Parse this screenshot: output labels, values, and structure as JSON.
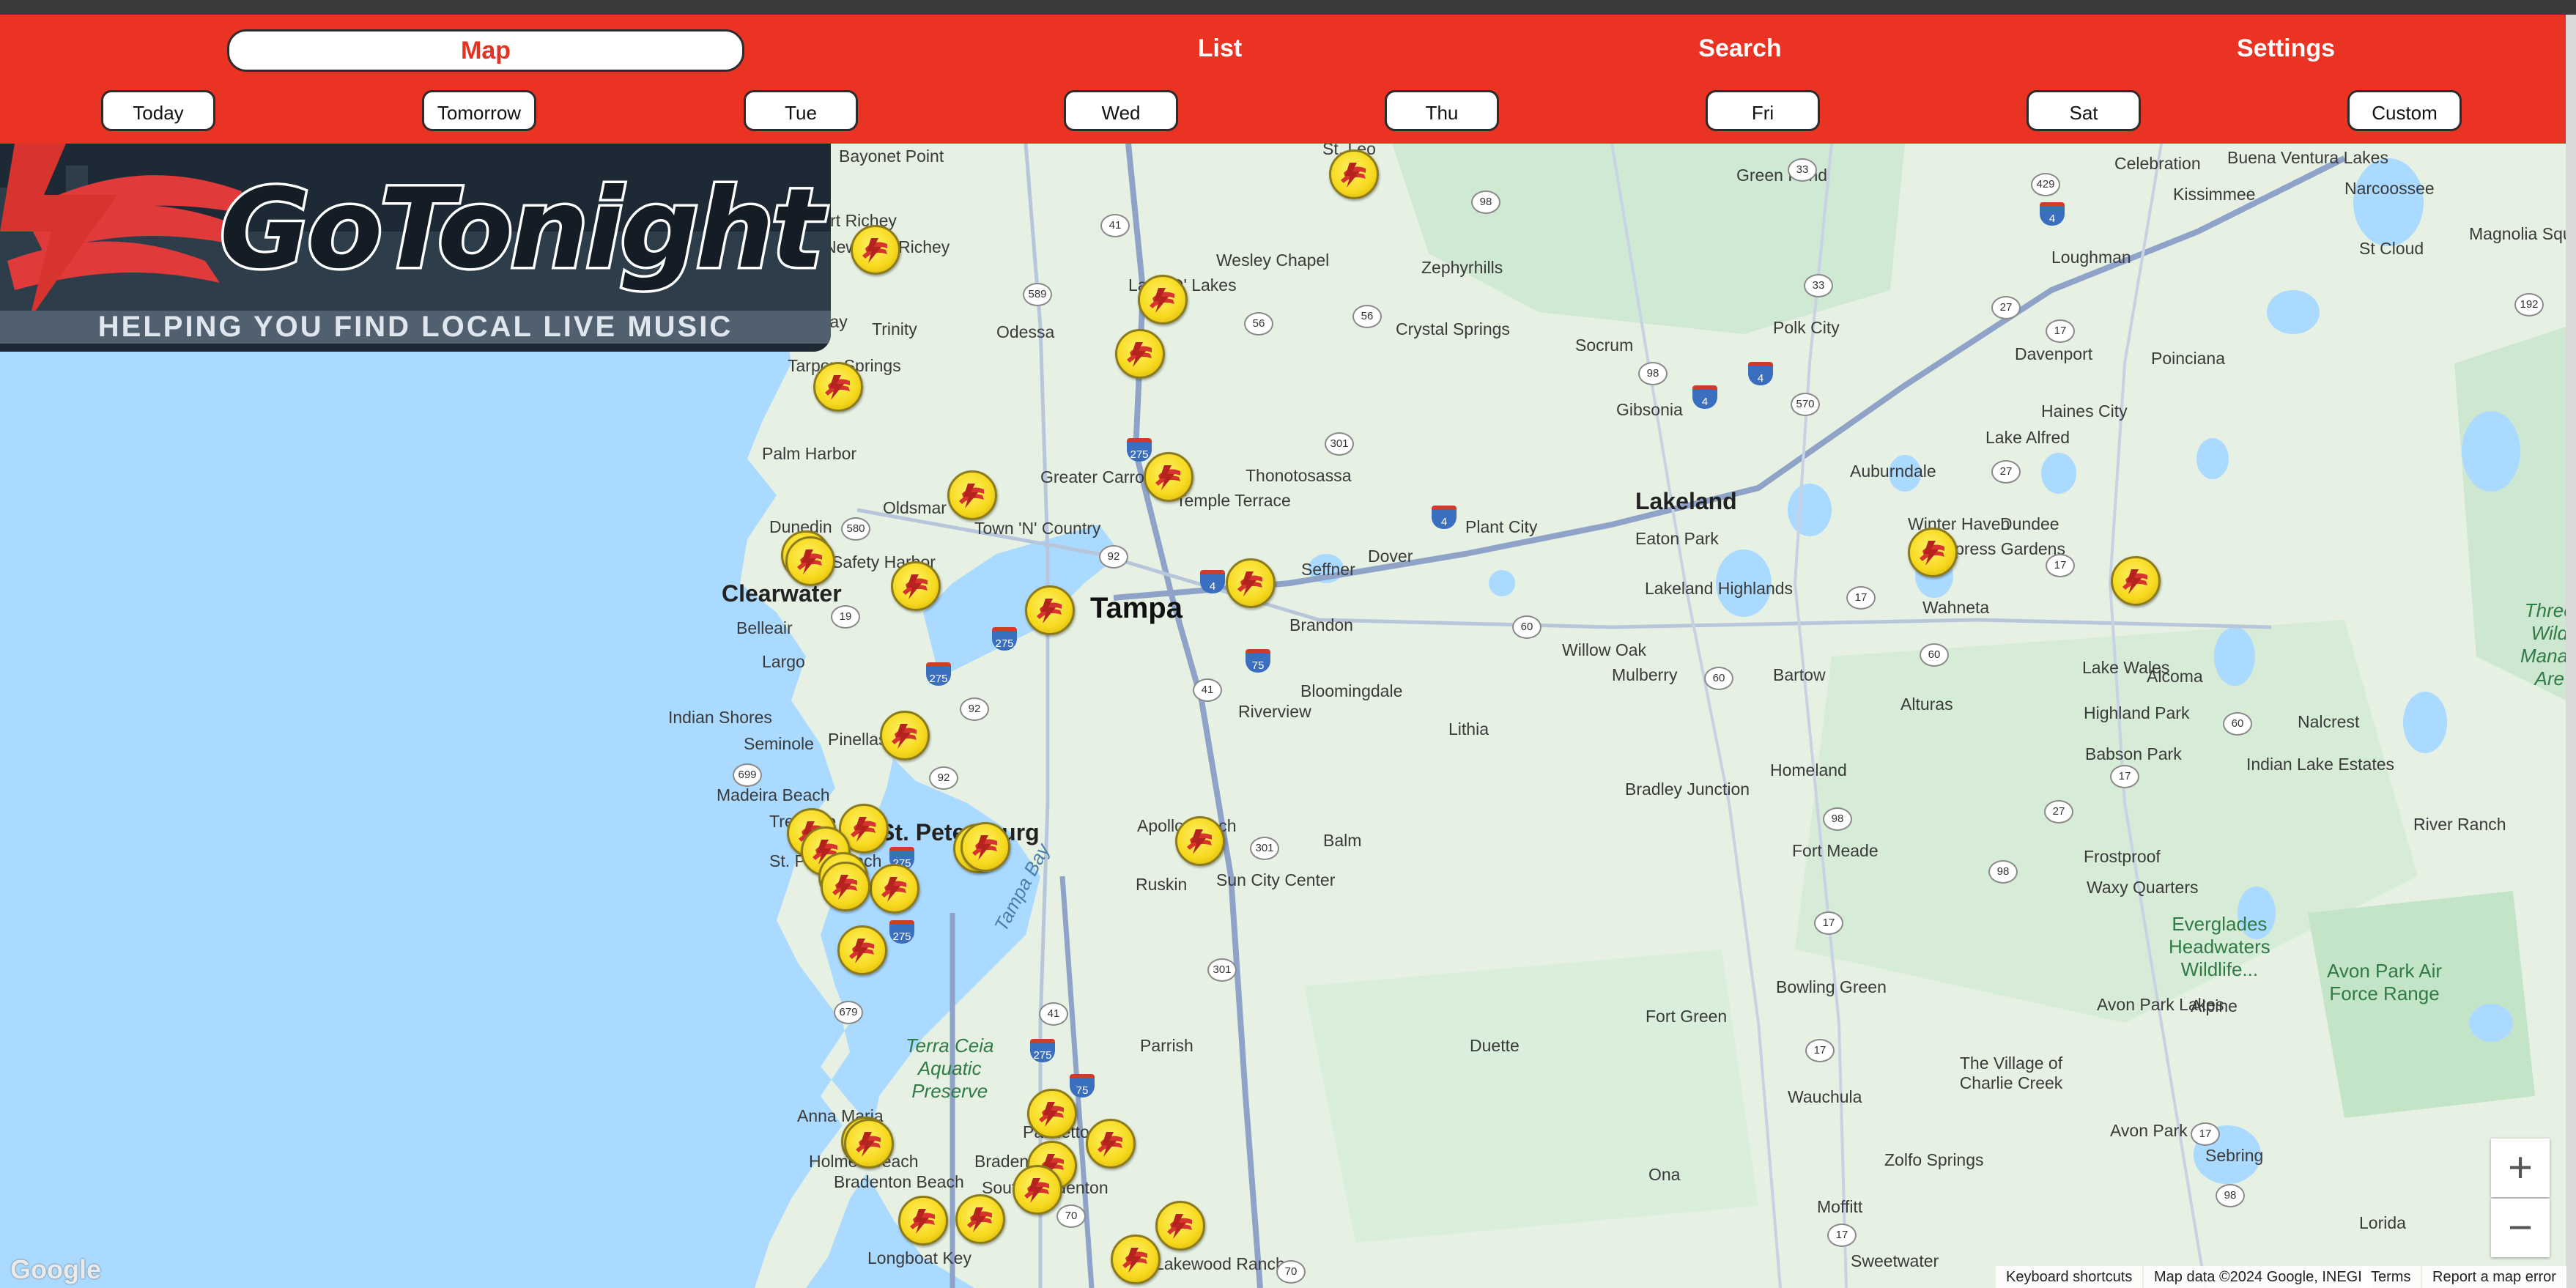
{
  "nav": {
    "tabs": [
      "Map",
      "List",
      "Search",
      "Settings"
    ],
    "active_tab": "Map",
    "days": [
      "Today",
      "Tomorrow",
      "Tue",
      "Wed",
      "Thu",
      "Fri",
      "Sat",
      "Custom"
    ]
  },
  "logo": {
    "wordmark": "GoTonight",
    "tagline": "HELPING YOU FIND LOCAL LIVE MUSIC"
  },
  "map": {
    "zoom_in": "+",
    "zoom_out": "−",
    "google": "Google",
    "attribution": [
      "Keyboard shortcuts",
      "Map data ©2024 Google, INEGI",
      "Terms",
      "Report a map error"
    ],
    "places": [
      "Bayonet Point",
      "Port Richey",
      "New Port Richey",
      "Holiday",
      "Trinity",
      "Tarpon Springs",
      "Palm Harbor",
      "Oldsmar",
      "Dunedin",
      "Safety Harbor",
      "Clearwater",
      "Belleair",
      "Largo",
      "Indian Shores",
      "Seminole",
      "Pinellas Park",
      "Madeira Beach",
      "Treasure Island",
      "St. Pete Beach",
      "St. Petersburg",
      "Town 'N' Country",
      "Greater Carrollwood",
      "Land O' Lakes",
      "Odessa",
      "Wesley Chapel",
      "Zephyrhills",
      "Crystal Springs",
      "St. Leo",
      "Temple Terrace",
      "Thonotosassa",
      "Seffner",
      "Dover",
      "Brandon",
      "Bloomingdale",
      "Riverview",
      "Lithia",
      "Plant City",
      "Lakeland",
      "Eaton Park",
      "Lakeland Highlands",
      "Willow Oak",
      "Mulberry",
      "Bartow",
      "Socrum",
      "Gibsonia",
      "Polk City",
      "Green Pond",
      "Auburndale",
      "Lake Alfred",
      "Winter Haven",
      "Cypress Gardens",
      "Wahneta",
      "Dundee",
      "Haines City",
      "Davenport",
      "Poinciana",
      "Loughman",
      "Kissimmee",
      "Celebration",
      "Buena Ventura Lakes",
      "Narcoossee",
      "St Cloud",
      "Magnolia Square",
      "Lake Wales",
      "Alcoma",
      "Alturas",
      "Highland Park",
      "Nalcrest",
      "Babson Park",
      "Indian Lake Estates",
      "River Ranch",
      "Frostproof",
      "Homeland",
      "Fort Meade",
      "Bradley Junction",
      "Apollo Beach",
      "Ruskin",
      "Sun City Center",
      "Balm",
      "Parrish",
      "Duette",
      "Fort Green",
      "Bowling Green",
      "Wauchula",
      "Zolfo Springs",
      "Ona",
      "Moffitt",
      "Sweetwater",
      "The Village of Charlie Creek",
      "Avon Park",
      "Avon Park Lakes",
      "Alpine",
      "Sebring",
      "Lorida",
      "Waxy Quarters",
      "Palmetto",
      "Bradenton",
      "Anna Maria",
      "Holmes Beach",
      "Bradenton Beach",
      "Longboat Key",
      "South Bradenton",
      "Lakewood Ranch"
    ],
    "water_labels": [
      "Tampa Bay"
    ],
    "park_labels": [
      "Terra Ceia Aquatic Preserve",
      "Everglades Headwaters Wildlife...",
      "Avon Park Air Force Range",
      "Three Lakes Wildlife Management Area"
    ],
    "marker_icon": "gotonight-venue-marker"
  }
}
